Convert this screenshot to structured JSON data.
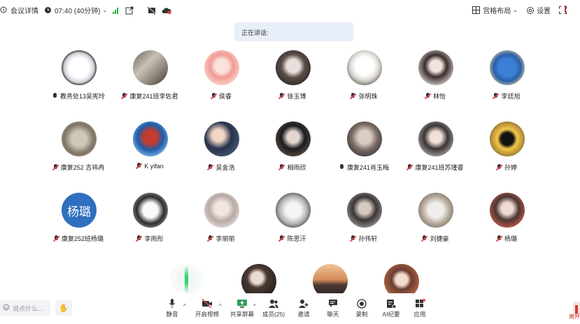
{
  "topbar": {
    "meeting_details": "会议详情",
    "time": "07:40 (40分钟)",
    "layout_label": "宫格布局",
    "settings_label": "设置"
  },
  "speaking_label": "正在讲话:",
  "participants": [
    {
      "name": "教务处13吴宪玲",
      "muted": false
    },
    {
      "name": "康复241班李佐君",
      "muted": true
    },
    {
      "name": "侯睿",
      "muted": true
    },
    {
      "name": "徐玉博",
      "muted": true
    },
    {
      "name": "张明珠",
      "muted": true
    },
    {
      "name": "林怡",
      "muted": true
    },
    {
      "name": "李廷旭",
      "muted": true
    },
    {
      "name": "康复252 吉祎冉",
      "muted": true
    },
    {
      "name": "K yifan",
      "muted": true
    },
    {
      "name": "吴金浩",
      "muted": true
    },
    {
      "name": "相雨欣",
      "muted": true
    },
    {
      "name": "康复241肖玉梅",
      "muted": false
    },
    {
      "name": "康复241班苏瑾睿",
      "muted": true
    },
    {
      "name": "孙婷",
      "muted": true
    },
    {
      "name": "康复252班杨璐",
      "muted": true,
      "avatar_text": "杨璐"
    },
    {
      "name": "李雨彤",
      "muted": true
    },
    {
      "name": "李丽丽",
      "muted": true
    },
    {
      "name": "陈思汗",
      "muted": true
    },
    {
      "name": "孙伟轩",
      "muted": true
    },
    {
      "name": "刘捷豪",
      "muted": true
    },
    {
      "name": "杨璐",
      "muted": true
    }
  ],
  "chat_placeholder": "说点什么...",
  "toolbar": {
    "mute": "静音",
    "video": "开启视频",
    "share": "共享屏幕",
    "members": "成员(25)",
    "invite": "邀请",
    "chat": "聊天",
    "record": "录制",
    "ai_minutes": "AI纪要",
    "apps": "应用"
  },
  "leave_label": "离开",
  "colors": {
    "accent_blue": "#2f6fc0",
    "mute_red": "#e0474c",
    "signal_green": "#28b04a",
    "banner_bg": "#e9eff9"
  }
}
